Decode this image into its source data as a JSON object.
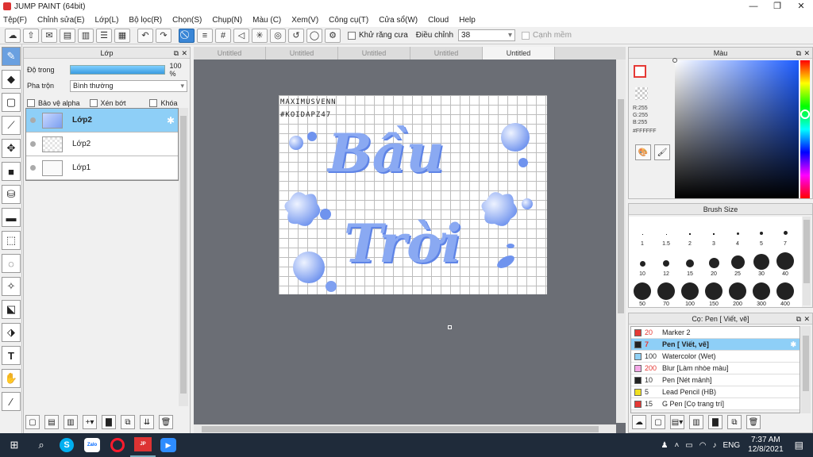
{
  "window": {
    "title": "JUMP PAINT (64bit)"
  },
  "menu": [
    "Tệp(F)",
    "Chỉnh sửa(E)",
    "Lớp(L)",
    "Bộ lọc(R)",
    "Chọn(S)",
    "Chụp(N)",
    "Màu (C)",
    "Xem(V)",
    "Công cụ(T)",
    "Cửa sổ(W)",
    "Cloud",
    "Help"
  ],
  "toolbar": {
    "antialias_label": "Khử răng cưa",
    "adjust_label": "Điều chỉnh",
    "adjust_value": "38",
    "sharpen_label": "Cạnh mềm"
  },
  "layer_panel": {
    "title": "Lớp",
    "opacity_label": "Độ trong",
    "opacity_value": "100 %",
    "blend_label": "Pha trộn",
    "blend_value": "Bình thường",
    "protect_alpha": "Bảo vệ alpha",
    "clip": "Xén bớt",
    "lock": "Khóa",
    "layers": [
      {
        "name": "Lớp2",
        "selected": true
      },
      {
        "name": "Lớp2",
        "selected": false
      },
      {
        "name": "Lớp1",
        "selected": false
      }
    ]
  },
  "tabs": [
    "Untitled",
    "Untitled",
    "Untitled",
    "Untitled",
    "Untitled"
  ],
  "canvas_text": {
    "line1": "MAXIMUSVENN",
    "line2": "#KOIDAPZ47",
    "word1": "Bầu",
    "word2": "Trời"
  },
  "color_panel": {
    "title": "Màu",
    "r": "R:255",
    "g": "G:255",
    "b": "B:255",
    "hex": "#FFFFFF"
  },
  "brush_panel": {
    "title": "Brush Size",
    "sizes": [
      "1",
      "1.5",
      "2",
      "3",
      "4",
      "5",
      "7",
      "10",
      "12",
      "15",
      "20",
      "25",
      "30",
      "40",
      "50",
      "70",
      "100",
      "150",
      "200",
      "300",
      "400"
    ]
  },
  "pen_panel": {
    "title": "Cọ: Pen [ Viết, vẽ]",
    "items": [
      {
        "size": "20",
        "name": "Marker 2",
        "color": "#e53935"
      },
      {
        "size": "7",
        "name": "Pen [ Viết, vẽ]",
        "color": "#222222"
      },
      {
        "size": "100",
        "name": "Watercolor (Wet)",
        "color": "#8fd0f5"
      },
      {
        "size": "200",
        "name": "Blur [Làm nhòe màu]",
        "color": "#f5a8e8"
      },
      {
        "size": "10",
        "name": "Pen [Nét mảnh]",
        "color": "#222222"
      },
      {
        "size": "5",
        "name": "Lead Pencil (HB)",
        "color": "#f0e020"
      },
      {
        "size": "15",
        "name": "G Pen [Cọ trang trí]",
        "color": "#e53935"
      }
    ]
  },
  "taskbar": {
    "time": "7:37 AM",
    "date": "12/8/2021",
    "lang": "ENG"
  }
}
